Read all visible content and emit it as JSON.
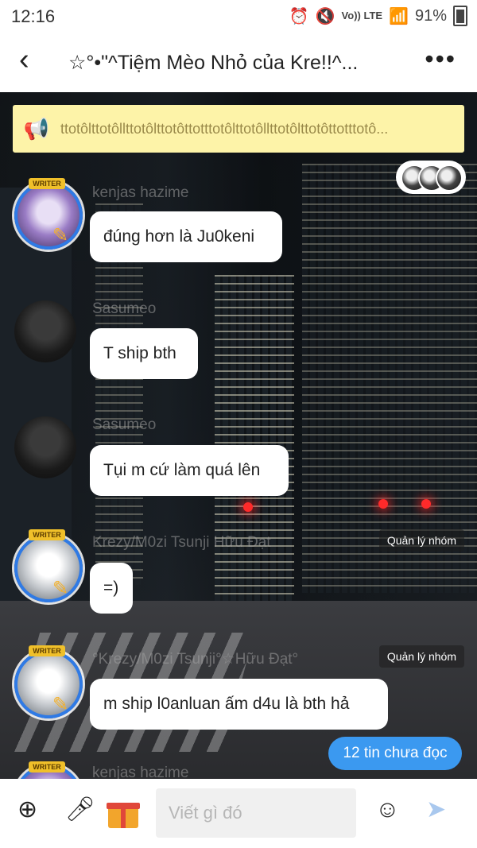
{
  "status": {
    "time": "12:16",
    "network": "Vo)) LTE",
    "battery": "91%"
  },
  "header": {
    "title": "☆°•\"^Tiệm Mèo Nhỏ của Kre!!^..."
  },
  "announcement": {
    "text": "ttotôlttotôllttotôlttotôttotttotôlttotôllttotôlttotôttotttotô..."
  },
  "messages": [
    {
      "name": "kenjas hazime",
      "text": "đúng hơn là Ju0keni",
      "avatar": "purple",
      "writer": true
    },
    {
      "name": "Sasumeo",
      "text": "T ship bth",
      "avatar": "dark",
      "writer": false
    },
    {
      "name": "Sasumeo",
      "text": "Tụi m cứ làm quá lên",
      "avatar": "dark",
      "writer": false
    },
    {
      "name": "Krezy/M0zi Tsunji Hữu Đạt",
      "text": "=)",
      "avatar": "white",
      "writer": true,
      "role": "Quản lý nhóm"
    },
    {
      "name": "°Krezy/M0zi Tsunji°☆Hữu Đạt°",
      "text": "m ship l0anluan ấm d4u là bth hả",
      "avatar": "white",
      "writer": true,
      "role": "Quản lý nhóm"
    },
    {
      "name": "kenjas hazime",
      "text": "",
      "avatar": "purple",
      "writer": true
    }
  ],
  "writer_badge": "WRITER",
  "unread_label": "12 tin chưa đọc",
  "composer": {
    "placeholder": "Viết gì đó"
  },
  "icons": [
    "back-arrow-icon",
    "more-icon",
    "megaphone-icon",
    "plus-icon",
    "mic-icon",
    "gift-icon",
    "emoji-icon",
    "send-icon"
  ],
  "colors": {
    "accent": "#3b99f0",
    "announce_bg": "#fdf3a8",
    "writer_ring": "#2f7ae5"
  }
}
